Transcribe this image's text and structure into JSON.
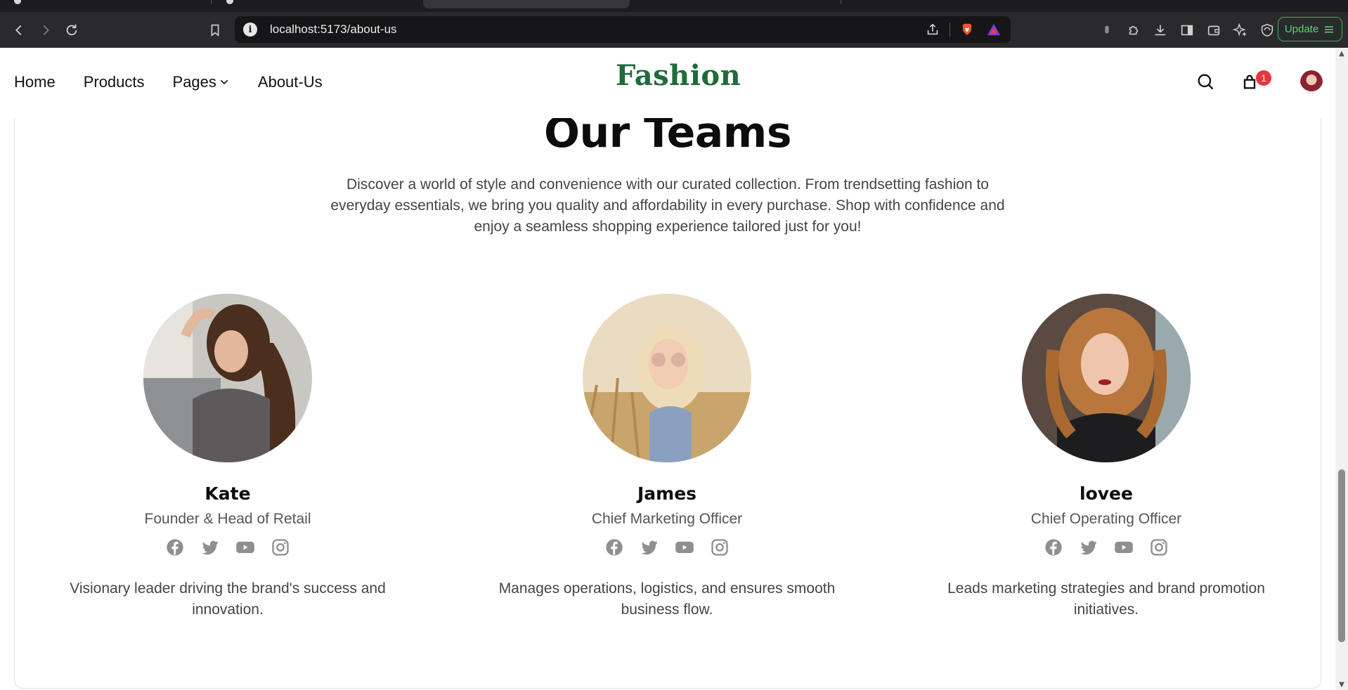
{
  "browser": {
    "url": "localhost:5173/about-us",
    "update_label": "Update"
  },
  "nav": {
    "links": [
      {
        "label": "Home"
      },
      {
        "label": "Products"
      },
      {
        "label": "Pages"
      },
      {
        "label": "About-Us"
      }
    ],
    "logo": "Fashion",
    "cart_count": "1"
  },
  "teams": {
    "title": "Our Teams",
    "description": "Discover a world of style and convenience with our curated collection. From trendsetting fashion to everyday essentials, we bring you quality and affordability in every purchase. Shop with confidence and enjoy a seamless shopping experience tailored just for you!",
    "members": [
      {
        "name": "Kate",
        "role": "Founder & Head of Retail",
        "bio": "Visionary leader driving the brand's success and innovation."
      },
      {
        "name": "James",
        "role": "Chief Marketing Officer",
        "bio": "Manages operations, logistics, and ensures smooth business flow."
      },
      {
        "name": "lovee",
        "role": "Chief Operating Officer",
        "bio": "Leads marketing strategies and brand promotion initiatives."
      }
    ],
    "social_icons": [
      "facebook-icon",
      "twitter-icon",
      "youtube-icon",
      "instagram-icon"
    ]
  },
  "colors": {
    "brand_green": "#1f6b3a",
    "badge_red": "#e8353d",
    "browser_dark": "#2a2a2c",
    "social_gray": "#8f8f8f"
  }
}
